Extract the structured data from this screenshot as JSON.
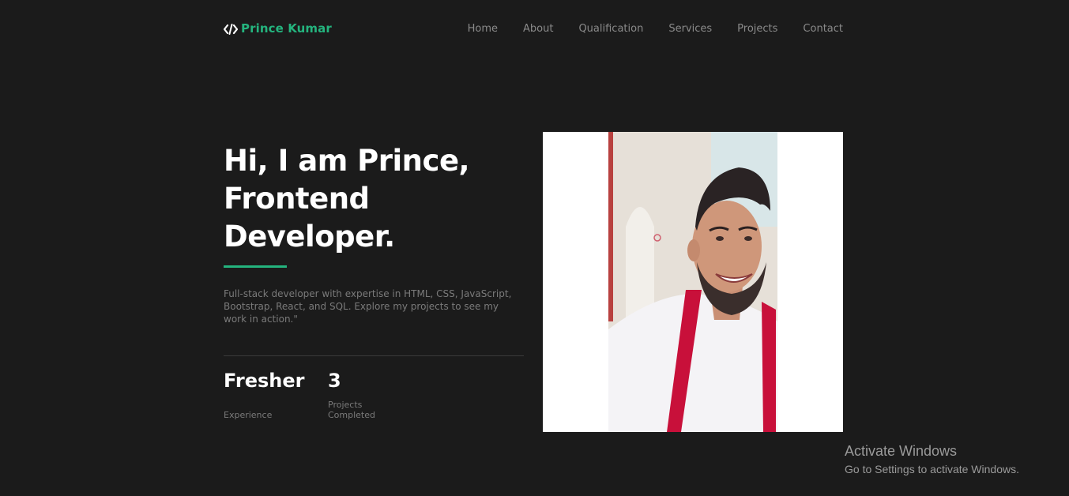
{
  "header": {
    "logo_text": "Prince Kumar",
    "logo_icon": "code-icon",
    "nav": [
      "Home",
      "About",
      "Qualification",
      "Services",
      "Projects",
      "Contact"
    ]
  },
  "hero": {
    "title_lines": [
      "Hi, I am Prince,",
      "Frontend",
      "Developer."
    ],
    "description": "Full-stack developer with expertise in HTML, CSS, JavaScript, Bootstrap, React, and SQL. Explore my projects to see my work in action.\"",
    "stats": [
      {
        "value": "Fresher",
        "label": "Experience"
      },
      {
        "value": "3",
        "label": "Projects Completed"
      }
    ]
  },
  "watermark": {
    "title": "Activate Windows",
    "subtitle": "Go to Settings to activate Windows."
  },
  "colors": {
    "background": "#1b1b1b",
    "accent": "#24b47e",
    "text": "#ffffff",
    "muted": "#7a7a7a"
  }
}
